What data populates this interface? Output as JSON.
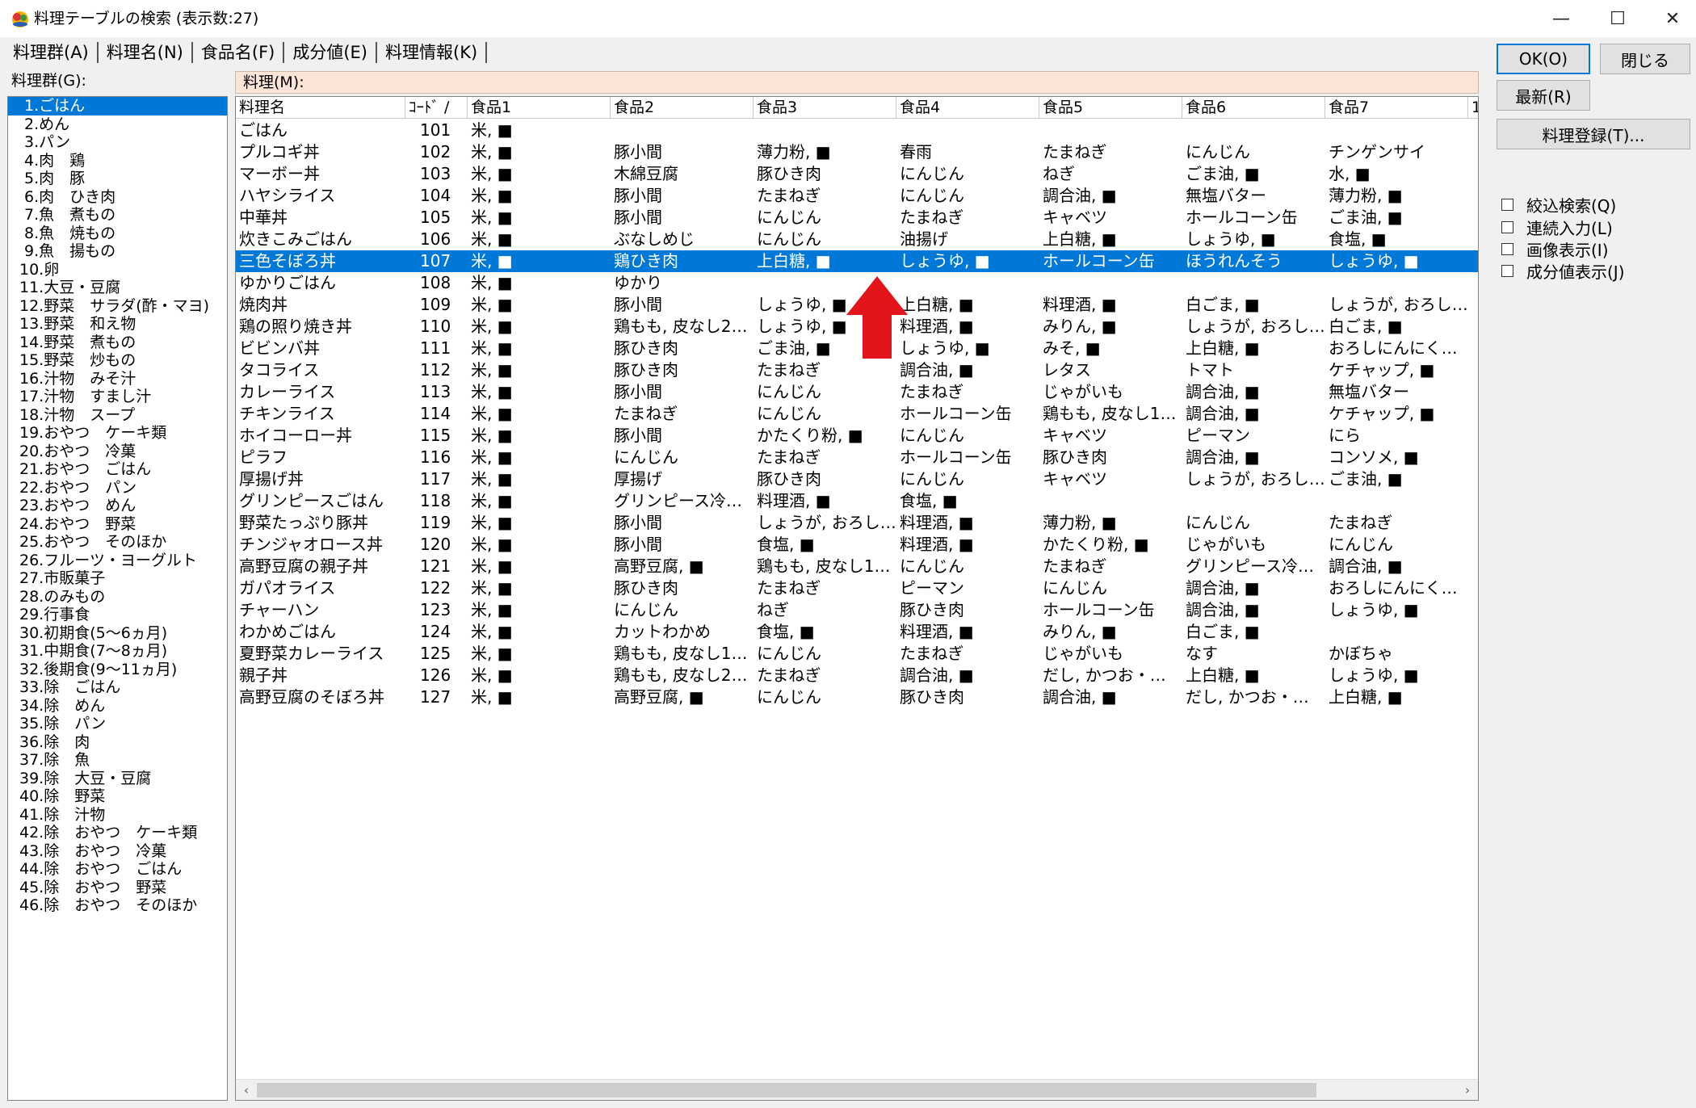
{
  "window": {
    "title": "料理テーブルの検索 (表示数:27)",
    "minimize": "—",
    "maximize": "☐",
    "close": "✕"
  },
  "tabs": [
    "料理群(A)",
    "料理名(N)",
    "食品名(F)",
    "成分値(E)",
    "料理情報(K)"
  ],
  "groups": {
    "label": "料理群(G):",
    "selected_index": 0,
    "items": [
      " 1.ごはん",
      " 2.めん",
      " 3.パン",
      " 4.肉　鶏",
      " 5.肉　豚",
      " 6.肉　ひき肉",
      " 7.魚　煮もの",
      " 8.魚　焼もの",
      " 9.魚　揚もの",
      "10.卵",
      "11.大豆・豆腐",
      "12.野菜　サラダ(酢・マヨ)",
      "13.野菜　和え物",
      "14.野菜　煮もの",
      "15.野菜　炒もの",
      "16.汁物　みそ汁",
      "17.汁物　すまし汁",
      "18.汁物　スープ",
      "19.おやつ　ケーキ類",
      "20.おやつ　冷菓",
      "21.おやつ　ごはん",
      "22.おやつ　パン",
      "23.おやつ　めん",
      "24.おやつ　野菜",
      "25.おやつ　そのほか",
      "26.フルーツ・ヨーグルト",
      "27.市販菓子",
      "28.のみもの",
      "29.行事食",
      "30.初期食(5～6ヵ月)",
      "31.中期食(7～8ヵ月)",
      "32.後期食(9～11ヵ月)",
      "33.除　ごはん",
      "34.除　めん",
      "35.除　パン",
      "36.除　肉",
      "37.除　魚",
      "39.除　大豆・豆腐",
      "40.除　野菜",
      "41.除　汁物",
      "42.除　おやつ　ケーキ類",
      "43.除　おやつ　冷菓",
      "44.除　おやつ　ごはん",
      "45.除　おやつ　野菜",
      "46.除　おやつ　そのほか"
    ]
  },
  "dish_label": "料理(M):",
  "table": {
    "columns": [
      "料理名",
      "ｺｰﾄﾞ ∕",
      "食品1",
      "食品2",
      "食品3",
      "食品4",
      "食品5",
      "食品6",
      "食品7",
      "1"
    ],
    "selected_index": 6,
    "rows": [
      [
        "ごはん",
        "101",
        "米, ■",
        "",
        "",
        "",
        "",
        "",
        ""
      ],
      [
        "プルコギ丼",
        "102",
        "米, ■",
        "豚小間",
        "薄力粉, ■",
        "春雨",
        "たまねぎ",
        "にんじん",
        "チンゲンサイ"
      ],
      [
        "マーボー丼",
        "103",
        "米, ■",
        "木綿豆腐",
        "豚ひき肉",
        "にんじん",
        "ねぎ",
        "ごま油, ■",
        "水, ■"
      ],
      [
        "ハヤシライス",
        "104",
        "米, ■",
        "豚小間",
        "たまねぎ",
        "にんじん",
        "調合油, ■",
        "無塩バター",
        "薄力粉, ■"
      ],
      [
        "中華丼",
        "105",
        "米, ■",
        "豚小間",
        "にんじん",
        "たまねぎ",
        "キャベツ",
        "ホールコーン缶",
        "ごま油, ■"
      ],
      [
        "炊きこみごはん",
        "106",
        "米, ■",
        "ぶなしめじ",
        "にんじん",
        "油揚げ",
        "上白糖, ■",
        "しょうゆ, ■",
        "食塩, ■"
      ],
      [
        "三色そぼろ丼",
        "107",
        "米, ■",
        "鶏ひき肉",
        "上白糖, ■",
        "しょうゆ, ■",
        "ホールコーン缶",
        "ほうれんそう",
        "しょうゆ, ■"
      ],
      [
        "ゆかりごはん",
        "108",
        "米, ■",
        "ゆかり",
        "",
        "",
        "",
        "",
        ""
      ],
      [
        "焼肉丼",
        "109",
        "米, ■",
        "豚小間",
        "しょうゆ, ■",
        "上白糖, ■",
        "料理酒, ■",
        "白ごま, ■",
        "しょうが, おろし…"
      ],
      [
        "鶏の照り焼き丼",
        "110",
        "米, ■",
        "鶏もも, 皮なし2…",
        "しょうゆ, ■",
        "料理酒, ■",
        "みりん, ■",
        "しょうが, おろし…",
        "白ごま, ■"
      ],
      [
        "ビビンバ丼",
        "111",
        "米, ■",
        "豚ひき肉",
        "ごま油, ■",
        "しょうゆ, ■",
        "みそ, ■",
        "上白糖, ■",
        "おろしにんにく…"
      ],
      [
        "タコライス",
        "112",
        "米, ■",
        "豚ひき肉",
        "たまねぎ",
        "調合油, ■",
        "レタス",
        "トマト",
        "ケチャップ, ■"
      ],
      [
        "カレーライス",
        "113",
        "米, ■",
        "豚小間",
        "にんじん",
        "たまねぎ",
        "じゃがいも",
        "調合油, ■",
        "無塩バター"
      ],
      [
        "チキンライス",
        "114",
        "米, ■",
        "たまねぎ",
        "にんじん",
        "ホールコーン缶",
        "鶏もも, 皮なし1…",
        "調合油, ■",
        "ケチャップ, ■"
      ],
      [
        "ホイコーロー丼",
        "115",
        "米, ■",
        "豚小間",
        "かたくり粉, ■",
        "にんじん",
        "キャベツ",
        "ピーマン",
        "にら"
      ],
      [
        "ピラフ",
        "116",
        "米, ■",
        "にんじん",
        "たまねぎ",
        "ホールコーン缶",
        "豚ひき肉",
        "調合油, ■",
        "コンソメ, ■"
      ],
      [
        "厚揚げ丼",
        "117",
        "米, ■",
        "厚揚げ",
        "豚ひき肉",
        "にんじん",
        "キャベツ",
        "しょうが, おろし…",
        "ごま油, ■"
      ],
      [
        "グリンピースごはん",
        "118",
        "米, ■",
        "グリンピース冷…",
        "料理酒, ■",
        "食塩, ■",
        "",
        "",
        ""
      ],
      [
        "野菜たっぷり豚丼",
        "119",
        "米, ■",
        "豚小間",
        "しょうが, おろし…",
        "料理酒, ■",
        "薄力粉, ■",
        "にんじん",
        "たまねぎ"
      ],
      [
        "チンジャオロース丼",
        "120",
        "米, ■",
        "豚小間",
        "食塩, ■",
        "料理酒, ■",
        "かたくり粉, ■",
        "じゃがいも",
        "にんじん"
      ],
      [
        "高野豆腐の親子丼",
        "121",
        "米, ■",
        "高野豆腐, ■",
        "鶏もも, 皮なし1…",
        "にんじん",
        "たまねぎ",
        "グリンピース冷…",
        "調合油, ■"
      ],
      [
        "ガパオライス",
        "122",
        "米, ■",
        "豚ひき肉",
        "たまねぎ",
        "ピーマン",
        "にんじん",
        "調合油, ■",
        "おろしにんにく…"
      ],
      [
        "チャーハン",
        "123",
        "米, ■",
        "にんじん",
        "ねぎ",
        "豚ひき肉",
        "ホールコーン缶",
        "調合油, ■",
        "しょうゆ, ■"
      ],
      [
        "わかめごはん",
        "124",
        "米, ■",
        "カットわかめ",
        "食塩, ■",
        "料理酒, ■",
        "みりん, ■",
        "白ごま, ■",
        ""
      ],
      [
        "夏野菜カレーライス",
        "125",
        "米, ■",
        "鶏もも, 皮なし1…",
        "にんじん",
        "たまねぎ",
        "じゃがいも",
        "なす",
        "かぼちゃ"
      ],
      [
        "親子丼",
        "126",
        "米, ■",
        "鶏もも, 皮なし2…",
        "たまねぎ",
        "調合油, ■",
        "だし, かつお・…",
        "上白糖, ■",
        "しょうゆ, ■"
      ],
      [
        "高野豆腐のそぼろ丼",
        "127",
        "米, ■",
        "高野豆腐, ■",
        "にんじん",
        "豚ひき肉",
        "調合油, ■",
        "だし, かつお・…",
        "上白糖, ■"
      ]
    ]
  },
  "scrollbar": {
    "left_arrow": "‹",
    "right_arrow": "›"
  },
  "buttons": {
    "ok": "OK(O)",
    "close": "閉じる",
    "refresh": "最新(R)",
    "register": "料理登録(T)..."
  },
  "checkboxes": [
    "絞込検索(Q)",
    "連続入力(L)",
    "画像表示(I)",
    "成分値表示(J)"
  ],
  "colors": {
    "selection": "#0078d7",
    "dish_label_bg": "#fce4d6",
    "arrow": "#e3141c"
  }
}
